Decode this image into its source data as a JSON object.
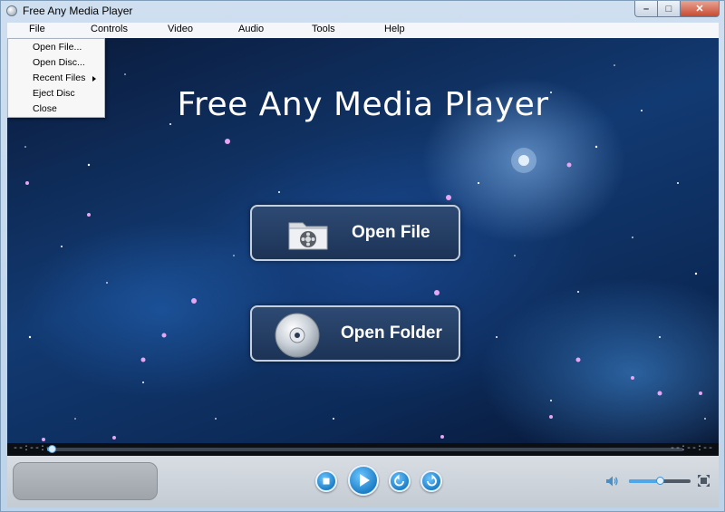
{
  "window": {
    "title": "Free Any Media Player",
    "buttons": {
      "minimize": "–",
      "maximize": "□",
      "close": "✕"
    }
  },
  "menubar": {
    "items": [
      "File",
      "Controls",
      "Video",
      "Audio",
      "Tools",
      "Help"
    ]
  },
  "file_menu": {
    "items": [
      {
        "label": "Open File..."
      },
      {
        "label": "Open Disc..."
      },
      {
        "label": "Recent Files",
        "submenu": true
      },
      {
        "label": "Eject Disc"
      },
      {
        "label": "Close"
      }
    ]
  },
  "main": {
    "app_title": "Free Any Media Player",
    "open_file_label": "Open File",
    "open_folder_label": "Open Folder"
  },
  "seekbar": {
    "time_elapsed": "--:--:--",
    "time_total": "--:--:--",
    "progress_fraction": 0.007
  },
  "controls": {
    "volume_fraction": 0.5
  },
  "colors": {
    "accent": "#4ea7ea",
    "button_bg": "#1c3356",
    "seekbar_bg": "#0b0e13"
  }
}
